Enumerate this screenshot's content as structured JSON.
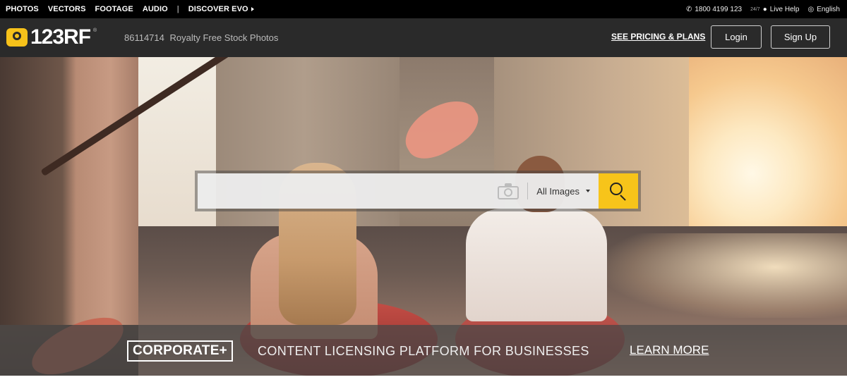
{
  "topbar": {
    "nav": [
      "PHOTOS",
      "VECTORS",
      "FOOTAGE",
      "AUDIO"
    ],
    "separator": "|",
    "discover": "DISCOVER EVO",
    "phone": "1800 4199 123",
    "live_help_prefix": "24/7",
    "live_help": "Live Help",
    "language": "English"
  },
  "header": {
    "logo_text": "123RF",
    "logo_reg": "®",
    "stock_count": "86114714",
    "tagline": "Royalty Free Stock Photos",
    "pricing_link": "SEE PRICING & PLANS",
    "login_label": "Login",
    "signup_label": "Sign Up"
  },
  "search": {
    "placeholder": "",
    "value": "",
    "category": "All Images",
    "icons": {
      "camera": "camera-icon",
      "search": "search-icon"
    },
    "button_color": "#f7c41a"
  },
  "banner": {
    "badge": "CORPORATE+",
    "text": "CONTENT LICENSING PLATFORM FOR BUSINESSES",
    "link": "LEARN MORE"
  },
  "colors": {
    "topbar_bg": "#000000",
    "header_bg": "#2a2a2a",
    "accent_yellow": "#f7c21a"
  }
}
